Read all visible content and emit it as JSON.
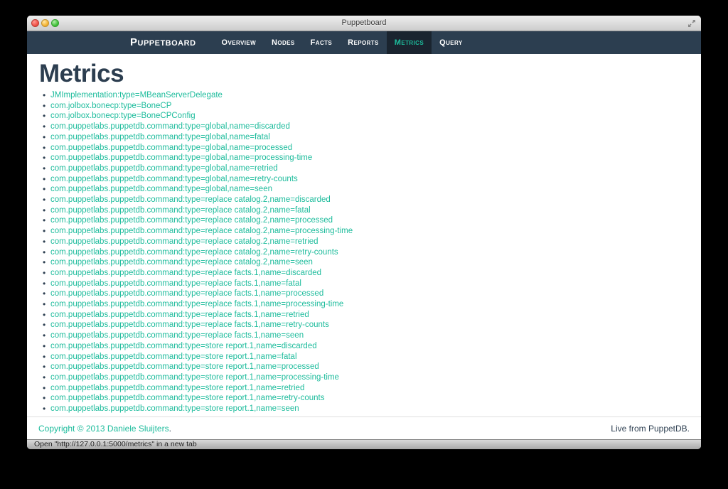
{
  "window": {
    "title": "Puppetboard",
    "status_bar": "Open \"http://127.0.0.1:5000/metrics\" in a new tab"
  },
  "navbar": {
    "brand": "Puppetboard",
    "items": [
      {
        "label": "Overview",
        "active": false
      },
      {
        "label": "Nodes",
        "active": false
      },
      {
        "label": "Facts",
        "active": false
      },
      {
        "label": "Reports",
        "active": false
      },
      {
        "label": "Metrics",
        "active": true
      },
      {
        "label": "Query",
        "active": false
      }
    ]
  },
  "page": {
    "title": "Metrics",
    "metrics": [
      "JMImplementation:type=MBeanServerDelegate",
      "com.jolbox.bonecp:type=BoneCP",
      "com.jolbox.bonecp:type=BoneCPConfig",
      "com.puppetlabs.puppetdb.command:type=global,name=discarded",
      "com.puppetlabs.puppetdb.command:type=global,name=fatal",
      "com.puppetlabs.puppetdb.command:type=global,name=processed",
      "com.puppetlabs.puppetdb.command:type=global,name=processing-time",
      "com.puppetlabs.puppetdb.command:type=global,name=retried",
      "com.puppetlabs.puppetdb.command:type=global,name=retry-counts",
      "com.puppetlabs.puppetdb.command:type=global,name=seen",
      "com.puppetlabs.puppetdb.command:type=replace catalog.2,name=discarded",
      "com.puppetlabs.puppetdb.command:type=replace catalog.2,name=fatal",
      "com.puppetlabs.puppetdb.command:type=replace catalog.2,name=processed",
      "com.puppetlabs.puppetdb.command:type=replace catalog.2,name=processing-time",
      "com.puppetlabs.puppetdb.command:type=replace catalog.2,name=retried",
      "com.puppetlabs.puppetdb.command:type=replace catalog.2,name=retry-counts",
      "com.puppetlabs.puppetdb.command:type=replace catalog.2,name=seen",
      "com.puppetlabs.puppetdb.command:type=replace facts.1,name=discarded",
      "com.puppetlabs.puppetdb.command:type=replace facts.1,name=fatal",
      "com.puppetlabs.puppetdb.command:type=replace facts.1,name=processed",
      "com.puppetlabs.puppetdb.command:type=replace facts.1,name=processing-time",
      "com.puppetlabs.puppetdb.command:type=replace facts.1,name=retried",
      "com.puppetlabs.puppetdb.command:type=replace facts.1,name=retry-counts",
      "com.puppetlabs.puppetdb.command:type=replace facts.1,name=seen",
      "com.puppetlabs.puppetdb.command:type=store report.1,name=discarded",
      "com.puppetlabs.puppetdb.command:type=store report.1,name=fatal",
      "com.puppetlabs.puppetdb.command:type=store report.1,name=processed",
      "com.puppetlabs.puppetdb.command:type=store report.1,name=processing-time",
      "com.puppetlabs.puppetdb.command:type=store report.1,name=retried",
      "com.puppetlabs.puppetdb.command:type=store report.1,name=retry-counts",
      "com.puppetlabs.puppetdb.command:type=store report.1,name=seen"
    ]
  },
  "footer": {
    "copyright": "Copyright © 2013 Daniele Sluijters",
    "period": ".",
    "right": "Live from PuppetDB."
  },
  "colors": {
    "accent": "#1dbc9c",
    "navbar_bg": "#2c3e50",
    "navbar_active_bg": "#1a242f",
    "heading": "#2c3e50"
  }
}
